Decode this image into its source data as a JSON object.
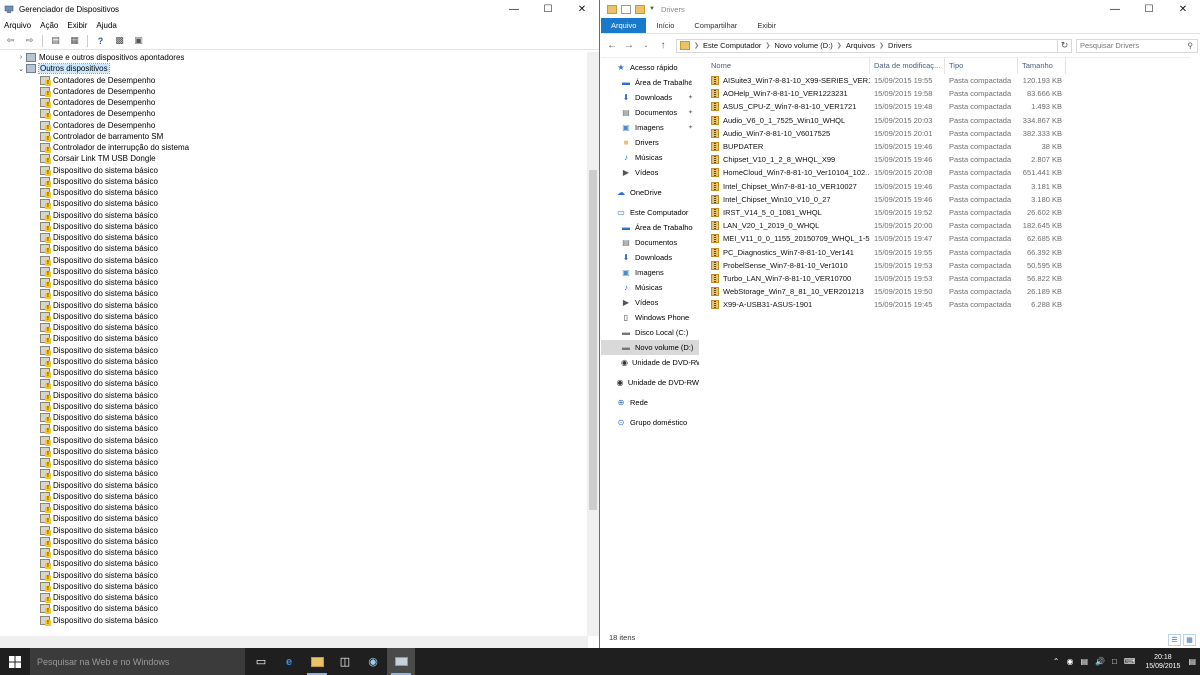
{
  "device_manager": {
    "title": "Gerenciador de Dispositivos",
    "menu": [
      "Arquivo",
      "Ação",
      "Exibir",
      "Ajuda"
    ],
    "tree": [
      {
        "label": "Mouse e outros dispositivos apontadores",
        "level": 0,
        "expander": "›",
        "icon": "mouse-icon"
      },
      {
        "label": "Outros dispositivos",
        "level": 0,
        "expander": "⌄",
        "icon": "other-devices-icon",
        "selected": true
      },
      {
        "label": "Contadores de Desempenho",
        "level": 1,
        "icon": "unknown-device-icon"
      },
      {
        "label": "Contadores de Desempenho",
        "level": 1,
        "icon": "unknown-device-icon"
      },
      {
        "label": "Contadores de Desempenho",
        "level": 1,
        "icon": "unknown-device-icon"
      },
      {
        "label": "Contadores de Desempenho",
        "level": 1,
        "icon": "unknown-device-icon"
      },
      {
        "label": "Contadores de Desempenho",
        "level": 1,
        "icon": "unknown-device-icon"
      },
      {
        "label": "Controlador de barramento SM",
        "level": 1,
        "icon": "unknown-device-icon"
      },
      {
        "label": "Controlador de interrupção do sistema",
        "level": 1,
        "icon": "unknown-device-icon"
      },
      {
        "label": "Corsair Link TM USB Dongle",
        "level": 1,
        "icon": "unknown-device-icon"
      },
      {
        "label": "Dispositivo do sistema básico",
        "level": 1,
        "icon": "unknown-device-icon"
      },
      {
        "label": "Dispositivo do sistema básico",
        "level": 1,
        "icon": "unknown-device-icon"
      },
      {
        "label": "Dispositivo do sistema básico",
        "level": 1,
        "icon": "unknown-device-icon"
      },
      {
        "label": "Dispositivo do sistema básico",
        "level": 1,
        "icon": "unknown-device-icon"
      },
      {
        "label": "Dispositivo do sistema básico",
        "level": 1,
        "icon": "unknown-device-icon"
      },
      {
        "label": "Dispositivo do sistema básico",
        "level": 1,
        "icon": "unknown-device-icon"
      },
      {
        "label": "Dispositivo do sistema básico",
        "level": 1,
        "icon": "unknown-device-icon"
      },
      {
        "label": "Dispositivo do sistema básico",
        "level": 1,
        "icon": "unknown-device-icon"
      },
      {
        "label": "Dispositivo do sistema básico",
        "level": 1,
        "icon": "unknown-device-icon"
      },
      {
        "label": "Dispositivo do sistema básico",
        "level": 1,
        "icon": "unknown-device-icon"
      },
      {
        "label": "Dispositivo do sistema básico",
        "level": 1,
        "icon": "unknown-device-icon"
      },
      {
        "label": "Dispositivo do sistema básico",
        "level": 1,
        "icon": "unknown-device-icon"
      },
      {
        "label": "Dispositivo do sistema básico",
        "level": 1,
        "icon": "unknown-device-icon"
      },
      {
        "label": "Dispositivo do sistema básico",
        "level": 1,
        "icon": "unknown-device-icon"
      },
      {
        "label": "Dispositivo do sistema básico",
        "level": 1,
        "icon": "unknown-device-icon"
      },
      {
        "label": "Dispositivo do sistema básico",
        "level": 1,
        "icon": "unknown-device-icon"
      },
      {
        "label": "Dispositivo do sistema básico",
        "level": 1,
        "icon": "unknown-device-icon"
      },
      {
        "label": "Dispositivo do sistema básico",
        "level": 1,
        "icon": "unknown-device-icon"
      },
      {
        "label": "Dispositivo do sistema básico",
        "level": 1,
        "icon": "unknown-device-icon"
      },
      {
        "label": "Dispositivo do sistema básico",
        "level": 1,
        "icon": "unknown-device-icon"
      },
      {
        "label": "Dispositivo do sistema básico",
        "level": 1,
        "icon": "unknown-device-icon"
      },
      {
        "label": "Dispositivo do sistema básico",
        "level": 1,
        "icon": "unknown-device-icon"
      },
      {
        "label": "Dispositivo do sistema básico",
        "level": 1,
        "icon": "unknown-device-icon"
      },
      {
        "label": "Dispositivo do sistema básico",
        "level": 1,
        "icon": "unknown-device-icon"
      },
      {
        "label": "Dispositivo do sistema básico",
        "level": 1,
        "icon": "unknown-device-icon"
      },
      {
        "label": "Dispositivo do sistema básico",
        "level": 1,
        "icon": "unknown-device-icon"
      },
      {
        "label": "Dispositivo do sistema básico",
        "level": 1,
        "icon": "unknown-device-icon"
      },
      {
        "label": "Dispositivo do sistema básico",
        "level": 1,
        "icon": "unknown-device-icon"
      },
      {
        "label": "Dispositivo do sistema básico",
        "level": 1,
        "icon": "unknown-device-icon"
      },
      {
        "label": "Dispositivo do sistema básico",
        "level": 1,
        "icon": "unknown-device-icon"
      },
      {
        "label": "Dispositivo do sistema básico",
        "level": 1,
        "icon": "unknown-device-icon"
      },
      {
        "label": "Dispositivo do sistema básico",
        "level": 1,
        "icon": "unknown-device-icon"
      },
      {
        "label": "Dispositivo do sistema básico",
        "level": 1,
        "icon": "unknown-device-icon"
      },
      {
        "label": "Dispositivo do sistema básico",
        "level": 1,
        "icon": "unknown-device-icon"
      },
      {
        "label": "Dispositivo do sistema básico",
        "level": 1,
        "icon": "unknown-device-icon"
      },
      {
        "label": "Dispositivo do sistema básico",
        "level": 1,
        "icon": "unknown-device-icon"
      },
      {
        "label": "Dispositivo do sistema básico",
        "level": 1,
        "icon": "unknown-device-icon"
      },
      {
        "label": "Dispositivo do sistema básico",
        "level": 1,
        "icon": "unknown-device-icon"
      },
      {
        "label": "Dispositivo do sistema básico",
        "level": 1,
        "icon": "unknown-device-icon"
      },
      {
        "label": "Dispositivo do sistema básico",
        "level": 1,
        "icon": "unknown-device-icon"
      },
      {
        "label": "Dispositivo do sistema básico",
        "level": 1,
        "icon": "unknown-device-icon"
      }
    ]
  },
  "explorer": {
    "title": "Drivers",
    "ribbon_tabs": [
      "Arquivo",
      "Início",
      "Compartilhar",
      "Exibir"
    ],
    "breadcrumb": [
      "Este Computador",
      "Novo volume (D:)",
      "Arquivos",
      "Drivers"
    ],
    "search_placeholder": "Pesquisar Drivers",
    "columns": {
      "name": "Nome",
      "date": "Data de modificaç...",
      "type": "Tipo",
      "size": "Tamanho"
    },
    "nav": [
      {
        "label": "Acesso rápido",
        "icon": "star-icon",
        "level": 0
      },
      {
        "label": "Área de Trabalhc",
        "icon": "desktop-icon",
        "level": 1,
        "pinned": true
      },
      {
        "label": "Downloads",
        "icon": "download-icon",
        "level": 1,
        "pinned": true
      },
      {
        "label": "Documentos",
        "icon": "documents-icon",
        "level": 1,
        "pinned": true
      },
      {
        "label": "Imagens",
        "icon": "images-icon",
        "level": 1,
        "pinned": true
      },
      {
        "label": "Drivers",
        "icon": "folder-icon",
        "level": 1
      },
      {
        "label": "Músicas",
        "icon": "music-icon",
        "level": 1
      },
      {
        "label": "Vídeos",
        "icon": "video-icon",
        "level": 1
      },
      {
        "label": "",
        "icon": "",
        "level": 0,
        "spacer": true
      },
      {
        "label": "OneDrive",
        "icon": "cloud-icon",
        "level": 0
      },
      {
        "label": "",
        "icon": "",
        "level": 0,
        "spacer": true
      },
      {
        "label": "Este Computador",
        "icon": "computer-icon",
        "level": 0
      },
      {
        "label": "Área de Trabalho",
        "icon": "desktop-icon",
        "level": 1
      },
      {
        "label": "Documentos",
        "icon": "documents-icon",
        "level": 1
      },
      {
        "label": "Downloads",
        "icon": "download-icon",
        "level": 1
      },
      {
        "label": "Imagens",
        "icon": "images-icon",
        "level": 1
      },
      {
        "label": "Músicas",
        "icon": "music-icon",
        "level": 1
      },
      {
        "label": "Vídeos",
        "icon": "video-icon",
        "level": 1
      },
      {
        "label": "Windows Phone",
        "icon": "phone-icon",
        "level": 1
      },
      {
        "label": "Disco Local (C:)",
        "icon": "drive-icon",
        "level": 1
      },
      {
        "label": "Novo volume (D:)",
        "icon": "drive-icon",
        "level": 1,
        "selected": true
      },
      {
        "label": "Unidade de DVD-RW",
        "icon": "dvd-icon",
        "level": 1
      },
      {
        "label": "",
        "icon": "",
        "level": 0,
        "spacer": true
      },
      {
        "label": "Unidade de DVD-RW",
        "icon": "dvd-icon",
        "level": 0
      },
      {
        "label": "",
        "icon": "",
        "level": 0,
        "spacer": true
      },
      {
        "label": "Rede",
        "icon": "network-icon",
        "level": 0
      },
      {
        "label": "",
        "icon": "",
        "level": 0,
        "spacer": true
      },
      {
        "label": "Grupo doméstico",
        "icon": "homegroup-icon",
        "level": 0
      }
    ],
    "files": [
      {
        "name": "AISuite3_Win7-8-81-10_X99-SERIES_VER1...",
        "date": "15/09/2015 19:55",
        "type": "Pasta compactada",
        "size": "120.193 KB"
      },
      {
        "name": "AOHelp_Win7-8-81-10_VER1223231",
        "date": "15/09/2015 19:58",
        "type": "Pasta compactada",
        "size": "83.666 KB"
      },
      {
        "name": "ASUS_CPU-Z_Win7-8-81-10_VER1721",
        "date": "15/09/2015 19:48",
        "type": "Pasta compactada",
        "size": "1.493 KB"
      },
      {
        "name": "Audio_V6_0_1_7525_Win10_WHQL",
        "date": "15/09/2015 20:03",
        "type": "Pasta compactada",
        "size": "334.867 KB"
      },
      {
        "name": "Audio_Win7-8-81-10_V6017525",
        "date": "15/09/2015 20:01",
        "type": "Pasta compactada",
        "size": "382.333 KB"
      },
      {
        "name": "BUPDATER",
        "date": "15/09/2015 19:46",
        "type": "Pasta compactada",
        "size": "38 KB"
      },
      {
        "name": "Chipset_V10_1_2_8_WHQL_X99",
        "date": "15/09/2015 19:46",
        "type": "Pasta compactada",
        "size": "2.807 KB"
      },
      {
        "name": "HomeCloud_Win7-8-81-10_Ver10104_102...",
        "date": "15/09/2015 20:08",
        "type": "Pasta compactada",
        "size": "651.441 KB"
      },
      {
        "name": "Intel_Chipset_Win7-8-81-10_VER10027",
        "date": "15/09/2015 19:46",
        "type": "Pasta compactada",
        "size": "3.181 KB"
      },
      {
        "name": "Intel_Chipset_Win10_V10_0_27",
        "date": "15/09/2015 19:46",
        "type": "Pasta compactada",
        "size": "3.180 KB"
      },
      {
        "name": "IRST_V14_5_0_1081_WHQL",
        "date": "15/09/2015 19:52",
        "type": "Pasta compactada",
        "size": "26.602 KB"
      },
      {
        "name": "LAN_V20_1_2019_0_WHQL",
        "date": "15/09/2015 20:00",
        "type": "Pasta compactada",
        "size": "182.645 KB"
      },
      {
        "name": "MEI_V11_0_0_1155_20150709_WHQL_1-5M",
        "date": "15/09/2015 19:47",
        "type": "Pasta compactada",
        "size": "62.685 KB"
      },
      {
        "name": "PC_Diagnostics_Win7-8-81-10_Ver141",
        "date": "15/09/2015 19:55",
        "type": "Pasta compactada",
        "size": "66.392 KB"
      },
      {
        "name": "ProbelSense_Win7-8-81-10_Ver1010",
        "date": "15/09/2015 19:53",
        "type": "Pasta compactada",
        "size": "50.595 KB"
      },
      {
        "name": "Turbo_LAN_Win7-8-81-10_VER10700",
        "date": "15/09/2015 19:53",
        "type": "Pasta compactada",
        "size": "56.822 KB"
      },
      {
        "name": "WebStorage_Win7_8_81_10_VER201213",
        "date": "15/09/2015 19:50",
        "type": "Pasta compactada",
        "size": "26.189 KB"
      },
      {
        "name": "X99-A-USB31-ASUS-1901",
        "date": "15/09/2015 19:45",
        "type": "Pasta compactada",
        "size": "6.288 KB"
      }
    ],
    "status": "18 itens"
  },
  "taskbar": {
    "search_placeholder": "Pesquisar na Web e no Windows",
    "time": "20:18",
    "date": "15/09/2015"
  }
}
